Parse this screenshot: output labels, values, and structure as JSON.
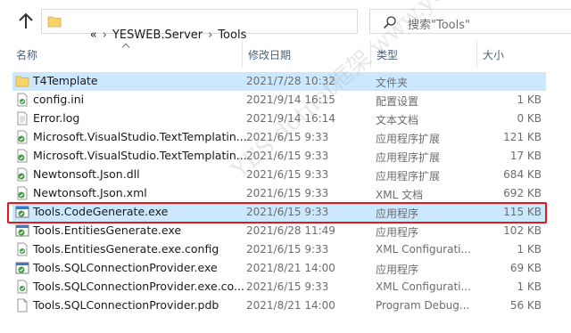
{
  "address": {
    "overflow": "«",
    "path": [
      "YESWEB.Server",
      "Tools"
    ]
  },
  "search": {
    "placeholder": "搜索\"Tools\""
  },
  "columns": {
    "name": "名称",
    "date": "修改日期",
    "type": "类型",
    "size": "大小"
  },
  "files": [
    {
      "name": "T4Template",
      "date": "2021/7/28 10:32",
      "type": "文件夹",
      "size": "",
      "icon": "folder-icon"
    },
    {
      "name": "config.ini",
      "date": "2021/9/14 16:15",
      "type": "配置设置",
      "size": "1 KB",
      "icon": "config-file-icon"
    },
    {
      "name": "Error.log",
      "date": "2021/9/14 16:14",
      "type": "文本文档",
      "size": "0 KB",
      "icon": "text-file-icon"
    },
    {
      "name": "Microsoft.VisualStudio.TextTemplatin...",
      "date": "2021/6/15 9:33",
      "type": "应用程序扩展",
      "size": "121 KB",
      "icon": "dll-file-icon"
    },
    {
      "name": "Microsoft.VisualStudio.TextTemplatin...",
      "date": "2021/6/15 9:33",
      "type": "应用程序扩展",
      "size": "17 KB",
      "icon": "dll-file-icon"
    },
    {
      "name": "Newtonsoft.Json.dll",
      "date": "2021/6/15 9:33",
      "type": "应用程序扩展",
      "size": "684 KB",
      "icon": "dll-file-icon"
    },
    {
      "name": "Newtonsoft.Json.xml",
      "date": "2021/6/15 9:33",
      "type": "XML 文档",
      "size": "692 KB",
      "icon": "xml-file-icon"
    },
    {
      "name": "Tools.CodeGenerate.exe",
      "date": "2021/6/15 9:33",
      "type": "应用程序",
      "size": "115 KB",
      "icon": "exe-file-icon"
    },
    {
      "name": "Tools.EntitiesGenerate.exe",
      "date": "2021/6/28 11:49",
      "type": "应用程序",
      "size": "102 KB",
      "icon": "exe-file-icon"
    },
    {
      "name": "Tools.EntitiesGenerate.exe.config",
      "date": "2021/6/15 9:33",
      "type": "XML Configurati...",
      "size": "1 KB",
      "icon": "config-file-icon"
    },
    {
      "name": "Tools.SQLConnectionProvider.exe",
      "date": "2021/8/21 14:00",
      "type": "应用程序",
      "size": "69 KB",
      "icon": "exe-file-icon"
    },
    {
      "name": "Tools.SQLConnectionProvider.exe.co...",
      "date": "2021/6/15 9:33",
      "type": "XML Configurati...",
      "size": "1 KB",
      "icon": "config-file-icon"
    },
    {
      "name": "Tools.SQLConnectionProvider.pdb",
      "date": "2021/8/21 14:00",
      "type": "Program Debug...",
      "size": "56 KB",
      "icon": "pdb-file-icon"
    }
  ],
  "watermark": "YES dotnet框架 www.yesdotnet.com",
  "colors": {
    "selection": "#cce8ff",
    "highlight_border": "#e5171a",
    "header_text": "#4c607a"
  }
}
